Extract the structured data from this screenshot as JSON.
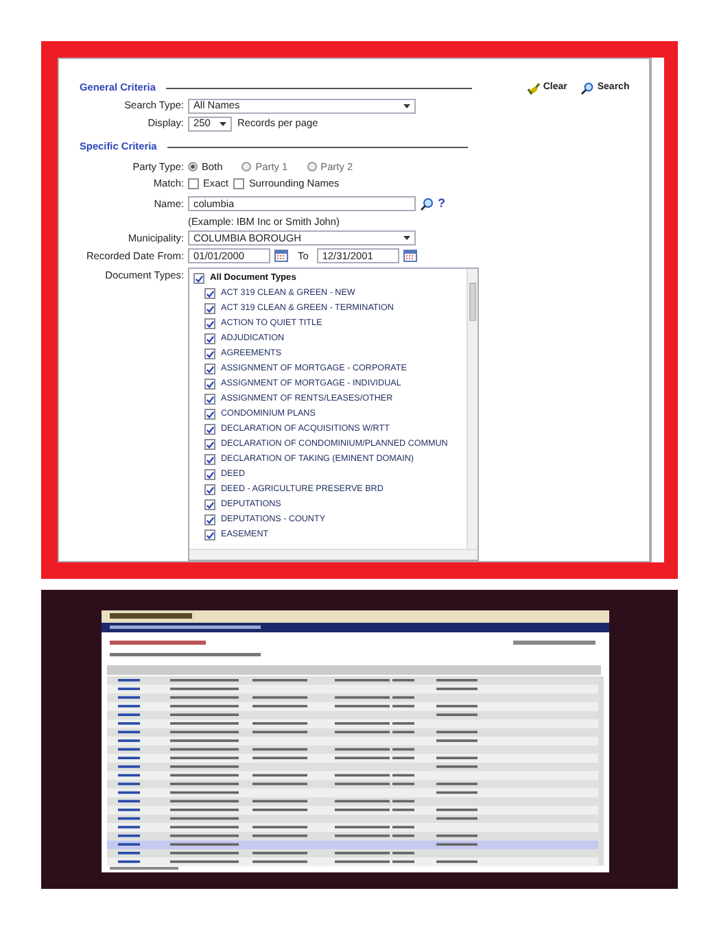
{
  "general_criteria": {
    "title": "General Criteria",
    "search_type": {
      "label": "Search Type:",
      "value": "All Names"
    },
    "display": {
      "label": "Display:",
      "value": "250",
      "suffix": "Records per page"
    }
  },
  "actions": [
    {
      "kind": "clear",
      "label": "Clear"
    },
    {
      "kind": "search",
      "label": "Search"
    }
  ],
  "specific_criteria": {
    "title": "Specific Criteria",
    "party_type": {
      "label": "Party Type:",
      "options": [
        {
          "label": "Both",
          "selected": true
        },
        {
          "label": "Party 1",
          "selected": false
        },
        {
          "label": "Party 2",
          "selected": false
        }
      ]
    },
    "match": {
      "label": "Match:",
      "options": [
        {
          "label": "Exact",
          "checked": false
        },
        {
          "label": "Surrounding Names",
          "checked": false
        }
      ]
    },
    "name": {
      "label": "Name:",
      "value": "columbia",
      "help": "?",
      "example": "(Example: IBM Inc or Smith John)"
    },
    "municipality": {
      "label": "Municipality:",
      "value": "COLUMBIA BOROUGH"
    },
    "recorded_date": {
      "label": "Recorded Date From:",
      "from": "01/01/2000",
      "to_label": "To",
      "to": "12/31/2001"
    },
    "document_types": {
      "label": "Document Types:",
      "all": {
        "label": "All Document Types",
        "checked": true
      },
      "items": [
        {
          "label": "ACT 319 CLEAN & GREEN - NEW",
          "checked": true
        },
        {
          "label": "ACT 319 CLEAN & GREEN - TERMINATION",
          "checked": true
        },
        {
          "label": "ACTION TO QUIET TITLE",
          "checked": true
        },
        {
          "label": "ADJUDICATION",
          "checked": true
        },
        {
          "label": "AGREEMENTS",
          "checked": true
        },
        {
          "label": "ASSIGNMENT OF MORTGAGE - CORPORATE",
          "checked": true
        },
        {
          "label": "ASSIGNMENT OF MORTGAGE - INDIVIDUAL",
          "checked": true
        },
        {
          "label": "ASSIGNMENT OF RENTS/LEASES/OTHER",
          "checked": true
        },
        {
          "label": "CONDOMINIUM PLANS",
          "checked": true
        },
        {
          "label": "DECLARATION OF ACQUISITIONS W/RTT",
          "checked": true
        },
        {
          "label": "DECLARATION OF CONDOMINIUM/PLANNED COMMUN",
          "checked": true
        },
        {
          "label": "DECLARATION OF TAKING (EMINENT DOMAIN)",
          "checked": true
        },
        {
          "label": "DEED",
          "checked": true
        },
        {
          "label": "DEED - AGRICULTURE PRESERVE BRD",
          "checked": true
        },
        {
          "label": "DEPUTATIONS",
          "checked": true
        },
        {
          "label": "DEPUTATIONS - COUNTY",
          "checked": true
        },
        {
          "label": "EASEMENT",
          "checked": true
        }
      ]
    }
  }
}
